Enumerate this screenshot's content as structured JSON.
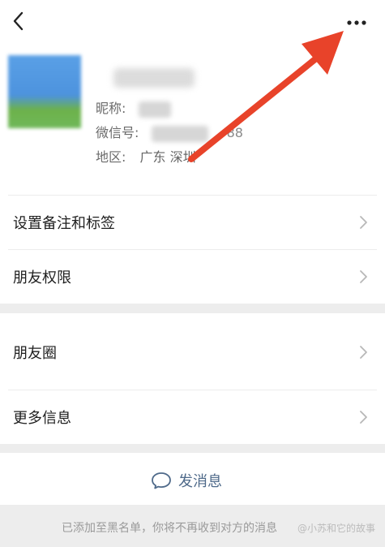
{
  "icons": {
    "back": "chevron-left-icon",
    "more": "more-horizontal-icon",
    "chevron": "chevron-right-icon",
    "message": "chat-bubble-icon",
    "arrow": "annotation-arrow"
  },
  "colors": {
    "arrow": "#e8432a",
    "send_text": "#4f6a8a",
    "gap": "#ededed"
  },
  "profile": {
    "nickname_label": "昵称:",
    "wechat_id_label": "微信号:",
    "wechat_id_tail": "88",
    "region_label": "地区:",
    "region_value": "广东  深圳"
  },
  "menu": {
    "items": [
      {
        "label": "设置备注和标签"
      },
      {
        "label": "朋友权限"
      },
      {
        "label": "朋友圈"
      },
      {
        "label": "更多信息"
      }
    ]
  },
  "actions": {
    "send_message": "发消息"
  },
  "notice": {
    "text": "已添加至黑名单，你将不再收到对方的消息",
    "watermark": "@小苏和它的故事"
  }
}
